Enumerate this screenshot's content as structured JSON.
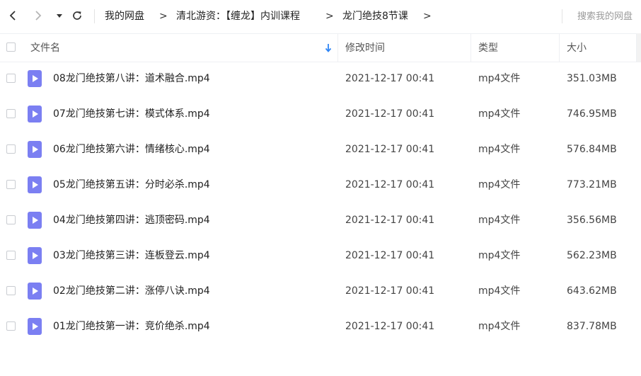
{
  "toolbar": {
    "back_icon": "chevron-left-icon",
    "forward_icon": "chevron-right-icon",
    "dropdown_icon": "caret-down-icon",
    "refresh_icon": "refresh-icon",
    "breadcrumb": [
      "我的网盘",
      "清北游资：【缠龙】内训课程",
      "龙门绝技8节课"
    ],
    "breadcrumb_separator": ">",
    "search_placeholder": "搜索我的网盘"
  },
  "table": {
    "headers": {
      "name": "文件名",
      "modified": "修改时间",
      "type": "类型",
      "size": "大小"
    },
    "sort_icon": "sort-down-arrow-icon",
    "file_icon": "video-file-icon",
    "accent_color": "#2f86f6",
    "file_icon_color": "#7b7ff2",
    "rows": [
      {
        "name": "08龙门绝技第八讲：道术融合.mp4",
        "modified": "2021-12-17 00:41",
        "type": "mp4文件",
        "size": "351.03MB"
      },
      {
        "name": "07龙门绝技第七讲：模式体系.mp4",
        "modified": "2021-12-17 00:41",
        "type": "mp4文件",
        "size": "746.95MB"
      },
      {
        "name": "06龙门绝技第六讲：情绪核心.mp4",
        "modified": "2021-12-17 00:41",
        "type": "mp4文件",
        "size": "576.84MB"
      },
      {
        "name": "05龙门绝技第五讲：分时必杀.mp4",
        "modified": "2021-12-17 00:41",
        "type": "mp4文件",
        "size": "773.21MB"
      },
      {
        "name": "04龙门绝技第四讲：逃顶密码.mp4",
        "modified": "2021-12-17 00:41",
        "type": "mp4文件",
        "size": "356.56MB"
      },
      {
        "name": "03龙门绝技第三讲：连板登云.mp4",
        "modified": "2021-12-17 00:41",
        "type": "mp4文件",
        "size": "562.23MB"
      },
      {
        "name": "02龙门绝技第二讲：涨停八诀.mp4",
        "modified": "2021-12-17 00:41",
        "type": "mp4文件",
        "size": "643.62MB"
      },
      {
        "name": "01龙门绝技第一讲：竞价绝杀.mp4",
        "modified": "2021-12-17 00:41",
        "type": "mp4文件",
        "size": "837.78MB"
      }
    ]
  }
}
